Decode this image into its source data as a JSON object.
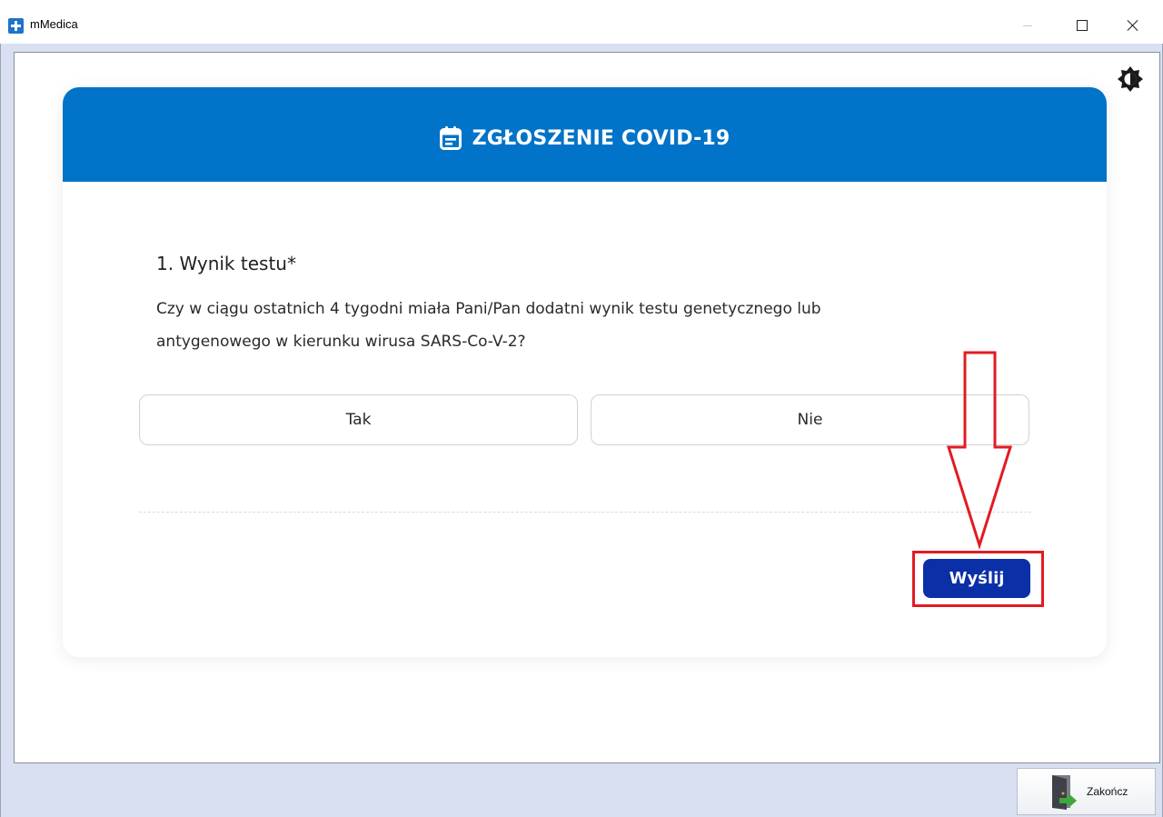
{
  "window": {
    "title": "mMedica",
    "icon": "medical-cross-icon"
  },
  "header": {
    "icon": "calendar-form-icon",
    "title": "ZGŁOSZENIE COVID-19",
    "color": "#0173c8"
  },
  "question": {
    "title": "1. Wynik testu*",
    "text_line1": "Czy w ciągu ostatnich 4 tygodni miała Pani/Pan dodatni wynik testu genetycznego lub",
    "text_line2": "antygenowego w kierunku wirusa SARS-Co-V-2?",
    "options": [
      "Tak",
      "Nie"
    ]
  },
  "actions": {
    "submit_label": "Wyślij",
    "submit_color": "#0a2fa7"
  },
  "annotation": {
    "color": "#e21b22"
  },
  "footer": {
    "exit_label": "Zakończ",
    "exit_icon": "exit-door-icon"
  },
  "theme_toggle_icon": "brightness-icon"
}
